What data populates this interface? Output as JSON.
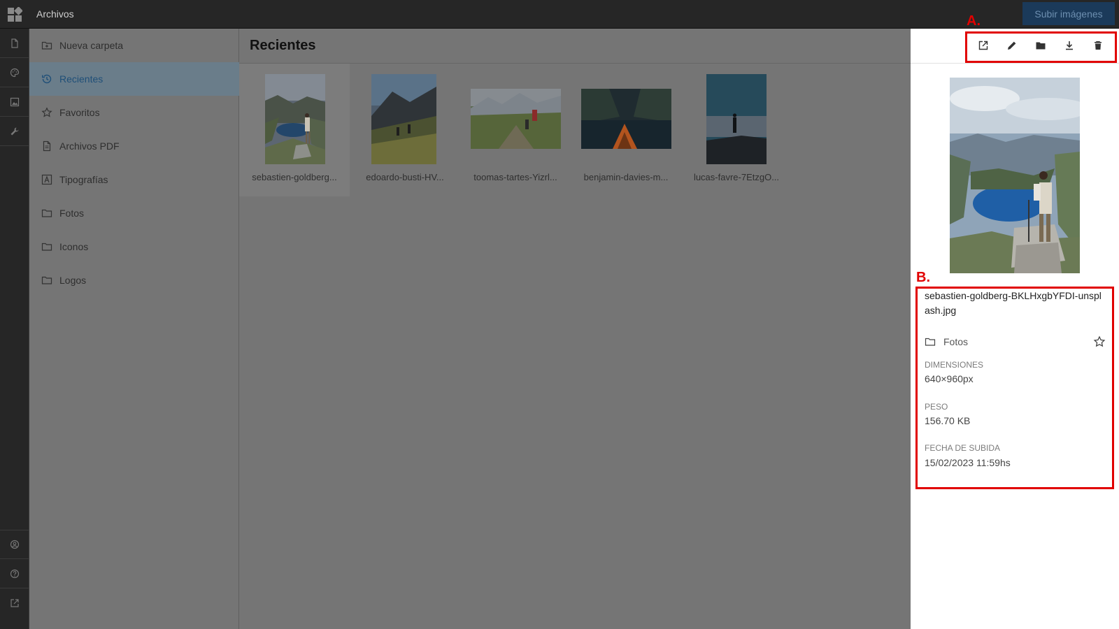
{
  "topbar": {
    "app_title": "Archivos",
    "upload_label": "Subir imágenes"
  },
  "rail": {
    "top_icons": [
      "file-icon",
      "palette-icon",
      "image-icon",
      "wrench-icon"
    ],
    "bottom_icons": [
      "user-circle-icon",
      "help-circle-icon",
      "external-link-icon"
    ]
  },
  "sidebar": {
    "items": [
      {
        "label": "Nueva carpeta",
        "icon": "folder-plus-icon"
      },
      {
        "label": "Recientes",
        "icon": "history-icon",
        "active": true
      },
      {
        "label": "Favoritos",
        "icon": "star-icon"
      },
      {
        "label": "Archivos PDF",
        "icon": "document-icon"
      },
      {
        "label": "Tipografías",
        "icon": "font-icon"
      },
      {
        "label": "Fotos",
        "icon": "folder-icon"
      },
      {
        "label": "Iconos",
        "icon": "folder-icon"
      },
      {
        "label": "Logos",
        "icon": "folder-icon"
      }
    ]
  },
  "main": {
    "title": "Recientes",
    "files": [
      {
        "name": "sebastien-goldberg..."
      },
      {
        "name": "edoardo-busti-HV..."
      },
      {
        "name": "toomas-tartes-Yizrl..."
      },
      {
        "name": "benjamin-davies-m..."
      },
      {
        "name": "lucas-favre-7EtzgO..."
      }
    ]
  },
  "details": {
    "toolbar_icons": [
      "open-external-icon",
      "edit-pencil-icon",
      "move-folder-icon",
      "download-icon",
      "trash-icon"
    ],
    "filename": "sebastien-goldberg-BKLHxgbYFDI-unsplash.jpg",
    "folder": "Fotos",
    "dimensions_label": "DIMENSIONES",
    "dimensions_value": "640×960px",
    "weight_label": "PESO",
    "weight_value": "156.70 KB",
    "upload_date_label": "FECHA DE SUBIDA",
    "upload_date_value": "15/02/2023 11:59hs"
  },
  "annotations": {
    "a_label": "A.",
    "b_label": "B."
  },
  "colors": {
    "accent": "#1f4f78",
    "annotation": "#e10000"
  }
}
